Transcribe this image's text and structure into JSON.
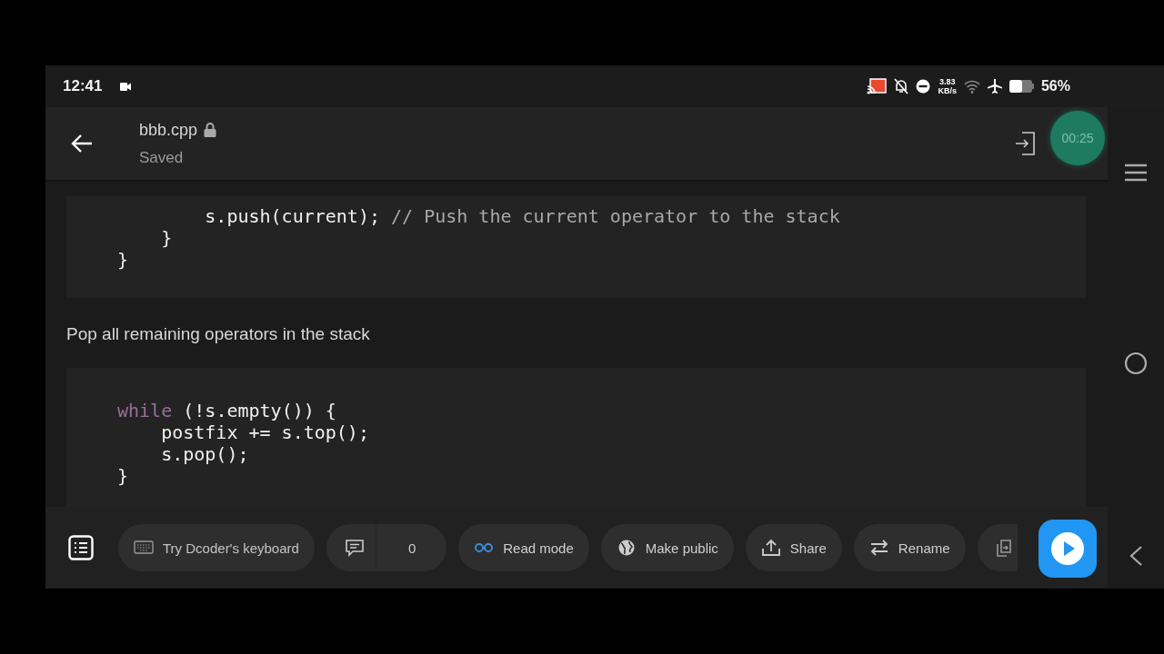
{
  "status_bar": {
    "time": "12:41",
    "net_speed": "3.83",
    "net_unit": "KB/s",
    "battery": "56%"
  },
  "app_bar": {
    "title": "bbb.cpp",
    "subtitle": "Saved"
  },
  "recording_timer": "00:25",
  "content": [
    {
      "kind": "code",
      "lines": [
        [
          {
            "kind": "plain",
            "text": "        s.push(current); "
          },
          {
            "kind": "comment",
            "text": "// Push the current operator to the stack"
          }
        ],
        [
          {
            "kind": "plain",
            "text": "    }"
          }
        ],
        [
          {
            "kind": "plain",
            "text": "}"
          }
        ]
      ]
    },
    {
      "kind": "text",
      "text": "Pop all remaining operators in the stack"
    },
    {
      "kind": "code",
      "lines": [
        [
          {
            "kind": "keyword",
            "text": "while"
          },
          {
            "kind": "plain",
            "text": " (!s.empty()) {"
          }
        ],
        [
          {
            "kind": "plain",
            "text": "    postfix += s.top();"
          }
        ],
        [
          {
            "kind": "plain",
            "text": "    s.pop();"
          }
        ],
        [
          {
            "kind": "plain",
            "text": "}"
          }
        ]
      ]
    }
  ],
  "bottom_actions": [
    {
      "kind": "keyboard",
      "label": "Try Dcoder's keyboard"
    },
    {
      "kind": "comments",
      "label": "0"
    },
    {
      "kind": "read",
      "label": "Read mode"
    },
    {
      "kind": "public",
      "label": "Make public"
    },
    {
      "kind": "share",
      "label": "Share"
    },
    {
      "kind": "rename",
      "label": "Rename"
    },
    {
      "kind": "copy"
    }
  ]
}
